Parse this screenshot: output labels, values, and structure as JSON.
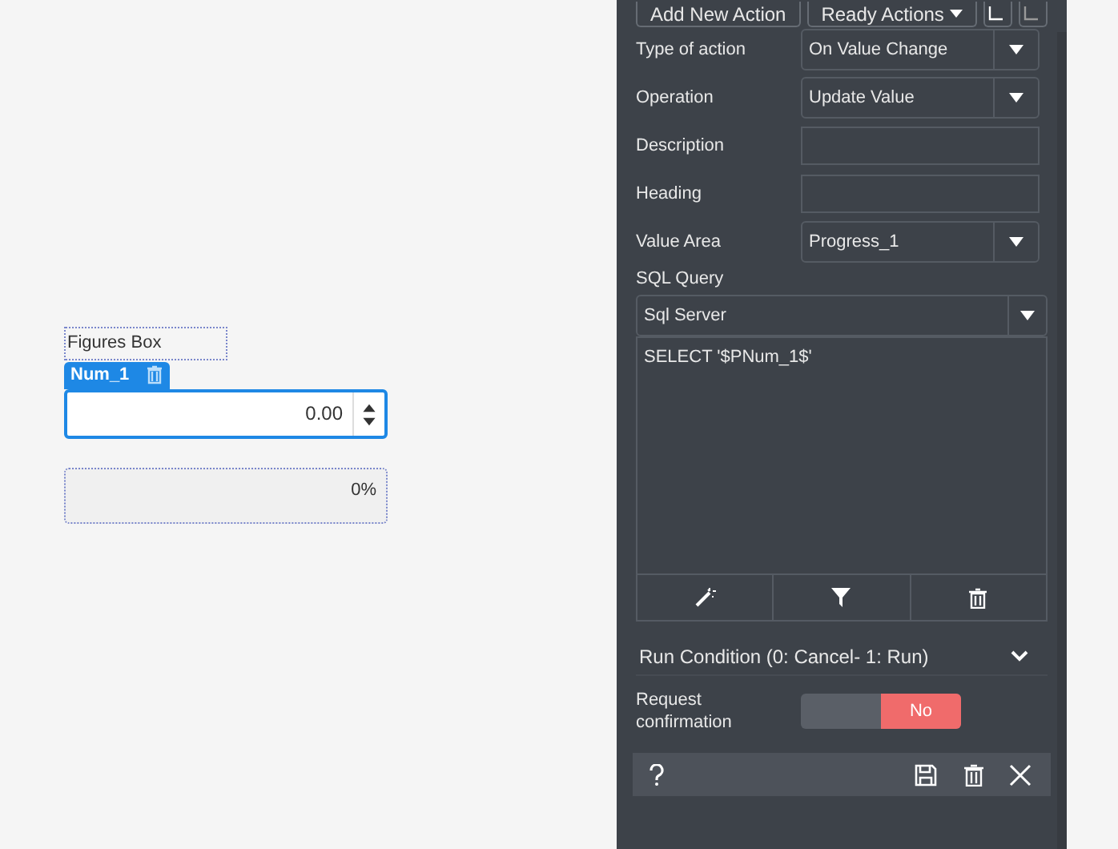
{
  "canvas": {
    "label": "Figures Box",
    "number_field": {
      "tag": "Num_1",
      "value": "0.00"
    },
    "progress": {
      "reading": "0%"
    }
  },
  "panel": {
    "toolbar": [
      "Add New Action",
      "Ready Actions"
    ],
    "fields": [
      {
        "label": "Type of action",
        "kind": "select",
        "value": "On Value Change"
      },
      {
        "label": "Operation",
        "kind": "select",
        "value": "Update Value"
      },
      {
        "label": "Description",
        "kind": "text"
      },
      {
        "label": "Heading",
        "kind": "text"
      },
      {
        "label": "Value Area",
        "kind": "select",
        "value": "Progress_1"
      }
    ],
    "sql": {
      "label": "SQL Query",
      "engine": "Sql Server",
      "query": "SELECT '$PNum_1$'"
    },
    "run_condition": {
      "label": "Run Condition (0: Cancel- 1: Run)",
      "expanded": false
    },
    "confirmation": {
      "label": "Request confirmation",
      "on": false,
      "state_text": "No"
    }
  }
}
